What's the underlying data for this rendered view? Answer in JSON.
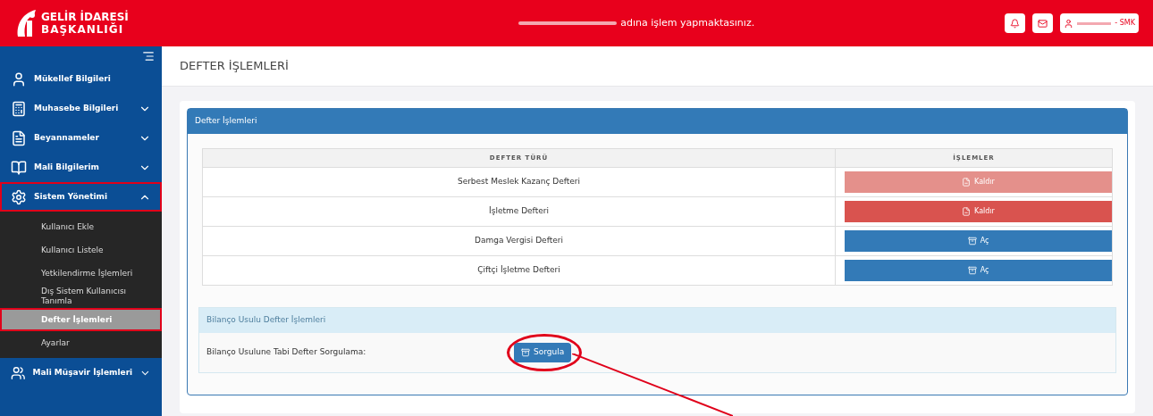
{
  "header": {
    "logo_line1": "GELİR İDARESİ",
    "logo_line2": "BAŞKANLIĞI",
    "notice": "adına işlem yapmaktasınız.",
    "user_suffix": "- SMK"
  },
  "sidebar": {
    "items": [
      {
        "label": "Mükellef Bilgileri",
        "kind": "user",
        "highlighted": false
      },
      {
        "label": "Muhasebe Bilgileri",
        "kind": "calculator",
        "expanded": false,
        "highlighted": false
      },
      {
        "label": "Beyannameler",
        "kind": "document",
        "expanded": false,
        "highlighted": false
      },
      {
        "label": "Mali Bilgilerim",
        "kind": "book",
        "expanded": false,
        "highlighted": false
      },
      {
        "label": "Sistem Yönetimi",
        "kind": "gear",
        "expanded": true,
        "highlighted": true,
        "children": [
          {
            "label": "Kullanıcı Ekle",
            "selected": false,
            "highlighted": false
          },
          {
            "label": "Kullanıcı Listele",
            "selected": false,
            "highlighted": false
          },
          {
            "label": "Yetkilendirme İşlemleri",
            "selected": false,
            "highlighted": false
          },
          {
            "label": "Dış Sistem Kullanıcısı Tanımla",
            "selected": false,
            "highlighted": false
          },
          {
            "label": "Defter İşlemleri",
            "selected": true,
            "highlighted": true
          },
          {
            "label": "Ayarlar",
            "selected": false,
            "highlighted": false
          }
        ]
      },
      {
        "label": "Mali Müşavir İşlemleri",
        "kind": "users",
        "expanded": false,
        "highlighted": false
      }
    ]
  },
  "page_title": "DEFTER İŞLEMLERİ",
  "panel": {
    "title": "Defter İşlemleri",
    "columns": [
      "DEFTER TÜRÜ",
      "İŞLEMLER"
    ],
    "rows": [
      {
        "name": "Serbest Meslek Kazanç Defteri",
        "action": {
          "label": "Kaldır",
          "kind": "remove",
          "disabled": true
        }
      },
      {
        "name": "İşletme Defteri",
        "action": {
          "label": "Kaldır",
          "kind": "remove",
          "disabled": false
        }
      },
      {
        "name": "Damga Vergisi Defteri",
        "action": {
          "label": "Aç",
          "kind": "open",
          "disabled": false
        }
      },
      {
        "name": "Çiftçi İşletme Defteri",
        "action": {
          "label": "Aç",
          "kind": "open",
          "disabled": false
        }
      }
    ]
  },
  "balance_section": {
    "title": "Bilanço Usulu Defter İşlemleri",
    "label": "Bilanço Usulune Tabi Defter Sorgulama:",
    "button": {
      "label": "Sorgula",
      "circled": true
    }
  }
}
